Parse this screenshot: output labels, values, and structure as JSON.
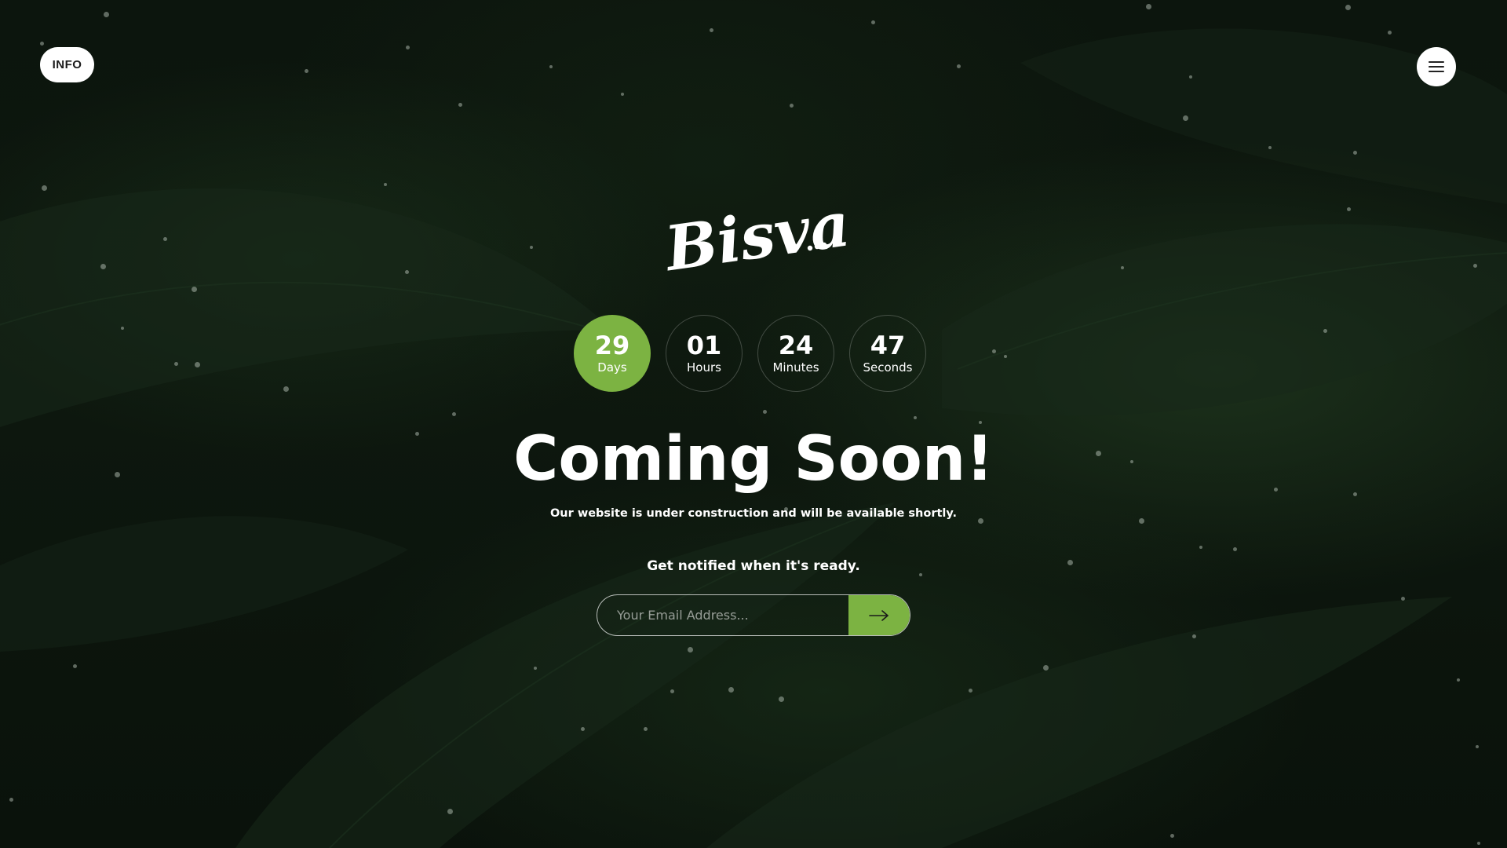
{
  "header": {
    "info_label": "INFO",
    "menu_icon": "hamburger-menu-icon"
  },
  "brand": {
    "logo_text": "Bisva"
  },
  "countdown": [
    {
      "value": "29",
      "unit": "Days",
      "active": true
    },
    {
      "value": "01",
      "unit": "Hours",
      "active": false
    },
    {
      "value": "24",
      "unit": "Minutes",
      "active": false
    },
    {
      "value": "47",
      "unit": "Seconds",
      "active": false
    }
  ],
  "hero": {
    "title": "Coming Soon!",
    "subtitle": "Our website is under construction and will be available shortly."
  },
  "subscribe": {
    "prompt": "Get notified when it's ready.",
    "placeholder": "Your Email Address...",
    "submit_icon": "arrow-right-icon"
  },
  "colors": {
    "accent": "#7cb342",
    "background": "#0b130c",
    "text": "#ffffff"
  }
}
